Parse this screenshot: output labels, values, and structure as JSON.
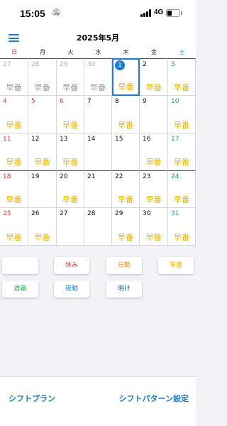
{
  "status_bar": {
    "time": "15:05",
    "network": "4G"
  },
  "header": {
    "month_title": "2025年5月"
  },
  "weekdays": [
    "日",
    "月",
    "火",
    "水",
    "木",
    "金",
    "土"
  ],
  "calendar_rows": [
    [
      {
        "day": "27",
        "shift": "早番",
        "kind": "other",
        "shift_style": "grey"
      },
      {
        "day": "28",
        "shift": "早番",
        "kind": "other",
        "shift_style": "grey"
      },
      {
        "day": "29",
        "shift": "早番",
        "kind": "other",
        "shift_style": "grey"
      },
      {
        "day": "30",
        "shift": "早番",
        "kind": "other",
        "shift_style": "grey"
      },
      {
        "day": "1",
        "shift": "早番",
        "kind": "today",
        "shift_style": "yellow"
      },
      {
        "day": "2",
        "shift": "早番",
        "kind": "normal",
        "shift_style": "yellow"
      },
      {
        "day": "3",
        "shift": "早番",
        "kind": "sat",
        "shift_style": "yellow"
      }
    ],
    [
      {
        "day": "4",
        "shift": "早番",
        "kind": "sun",
        "shift_style": "yellow"
      },
      {
        "day": "5",
        "shift": "",
        "kind": "holiday",
        "shift_style": "yellow"
      },
      {
        "day": "6",
        "shift": "早番",
        "kind": "holiday",
        "shift_style": "yellow"
      },
      {
        "day": "7",
        "shift": "",
        "kind": "normal",
        "shift_style": "yellow"
      },
      {
        "day": "8",
        "shift": "早番",
        "kind": "normal",
        "shift_style": "yellow"
      },
      {
        "day": "9",
        "shift": "",
        "kind": "normal",
        "shift_style": "yellow"
      },
      {
        "day": "10",
        "shift": "早番",
        "kind": "sat",
        "shift_style": "yellow"
      }
    ],
    [
      {
        "day": "11",
        "shift": "早番",
        "kind": "sun",
        "shift_style": "yellow"
      },
      {
        "day": "12",
        "shift": "早番",
        "kind": "normal",
        "shift_style": "yellow"
      },
      {
        "day": "13",
        "shift": "早番",
        "kind": "normal",
        "shift_style": "yellow"
      },
      {
        "day": "14",
        "shift": "",
        "kind": "normal",
        "shift_style": "yellow"
      },
      {
        "day": "15",
        "shift": "",
        "kind": "normal",
        "shift_style": "yellow"
      },
      {
        "day": "16",
        "shift": "早番",
        "kind": "normal",
        "shift_style": "yellow"
      },
      {
        "day": "17",
        "shift": "早番",
        "kind": "sat",
        "shift_style": "yellow"
      }
    ],
    [
      {
        "day": "18",
        "shift": "早番",
        "kind": "sun",
        "shift_style": "yellow"
      },
      {
        "day": "19",
        "shift": "",
        "kind": "normal",
        "shift_style": "yellow"
      },
      {
        "day": "20",
        "shift": "早番",
        "kind": "normal",
        "shift_style": "yellow"
      },
      {
        "day": "21",
        "shift": "",
        "kind": "normal",
        "shift_style": "yellow"
      },
      {
        "day": "22",
        "shift": "早番",
        "kind": "normal",
        "shift_style": "yellow"
      },
      {
        "day": "23",
        "shift": "早番",
        "kind": "normal",
        "shift_style": "yellow"
      },
      {
        "day": "24",
        "shift": "早番",
        "kind": "sat",
        "shift_style": "yellow"
      }
    ],
    [
      {
        "day": "25",
        "shift": "早番",
        "kind": "sun",
        "shift_style": "yellow"
      },
      {
        "day": "26",
        "shift": "早番",
        "kind": "normal",
        "shift_style": "yellow"
      },
      {
        "day": "27",
        "shift": "",
        "kind": "normal",
        "shift_style": "yellow"
      },
      {
        "day": "28",
        "shift": "",
        "kind": "normal",
        "shift_style": "yellow"
      },
      {
        "day": "29",
        "shift": "早番",
        "kind": "normal",
        "shift_style": "yellow"
      },
      {
        "day": "30",
        "shift": "早番",
        "kind": "normal",
        "shift_style": "yellow"
      },
      {
        "day": "31",
        "shift": "早番",
        "kind": "sat",
        "shift_style": "yellow"
      }
    ]
  ],
  "shift_buttons": {
    "blank": "",
    "rest": "休み",
    "day_shift": "日勤",
    "early": "早番",
    "late": "遅番",
    "night": "夜勤",
    "after_night": "明け"
  },
  "bottom_bar": {
    "left_link": "シフトプラン",
    "right_link": "シフトパターン設定"
  },
  "colors": {
    "accent": "#1a7cd8",
    "sunday": "#e53935",
    "saturday": "#1e88e5",
    "early_shift": "#f0b400",
    "rest": "#e53935",
    "day_shift": "#f08c00",
    "late_shift": "#2fb157",
    "night_shift": "#1e88e5"
  }
}
